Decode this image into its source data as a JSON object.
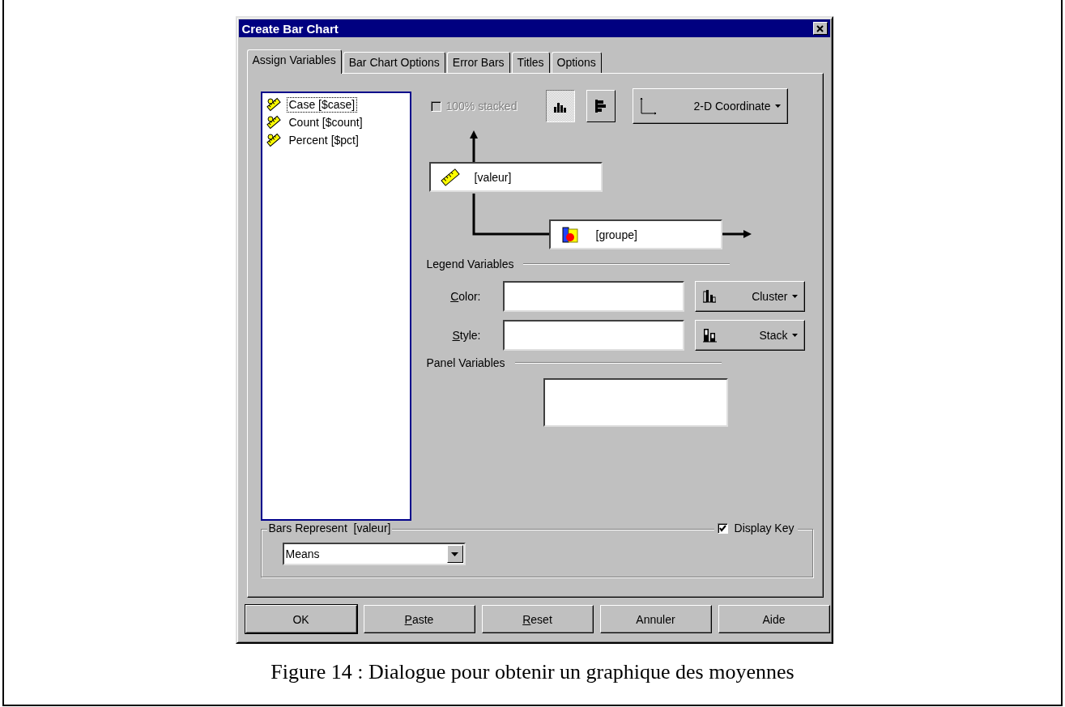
{
  "window": {
    "title": "Create Bar Chart"
  },
  "tabs": [
    {
      "label": "Assign Variables",
      "selected": true
    },
    {
      "label": "Bar Chart Options",
      "selected": false
    },
    {
      "label": "Error Bars",
      "selected": false
    },
    {
      "label": "Titles",
      "selected": false
    },
    {
      "label": "Options",
      "selected": false
    }
  ],
  "variables": [
    {
      "label": "Case [$case]",
      "focused": true
    },
    {
      "label": "Count [$count]",
      "focused": false
    },
    {
      "label": "Percent [$pct]",
      "focused": false
    }
  ],
  "stacked_checkbox": {
    "label": "100% stacked",
    "checked": false,
    "disabled": true
  },
  "orientation_buttons": [
    {
      "kind": "vertical",
      "selected": true
    },
    {
      "kind": "horizontal",
      "selected": false
    }
  ],
  "coordinate_button": {
    "label": "2-D Coordinate"
  },
  "y_axis": {
    "value": "[valeur]"
  },
  "x_axis": {
    "value": "[groupe]"
  },
  "legend": {
    "title": "Legend Variables",
    "rows": [
      {
        "label": "Color:",
        "mnemonic": true,
        "mode": {
          "kind": "cluster",
          "label": "Cluster"
        }
      },
      {
        "label": "Style:",
        "mnemonic": true,
        "mode": {
          "kind": "stack",
          "label": "Stack"
        }
      }
    ]
  },
  "panel": {
    "title": "Panel Variables"
  },
  "bars_represent": {
    "title": "Bars Represent  [valeur]",
    "value": "Means",
    "display_key": {
      "label": "Display Key",
      "checked": true
    }
  },
  "buttons": [
    {
      "label": "OK",
      "default": true,
      "mnemonic": false
    },
    {
      "label": "Paste",
      "default": false,
      "mnemonic": true
    },
    {
      "label": "Reset",
      "default": false,
      "mnemonic": true
    },
    {
      "label": "Annuler",
      "default": false,
      "mnemonic": false
    },
    {
      "label": "Aide",
      "default": false,
      "mnemonic": false
    }
  ],
  "caption": "Figure 14 : Dialogue pour obtenir un graphique des moyennes"
}
